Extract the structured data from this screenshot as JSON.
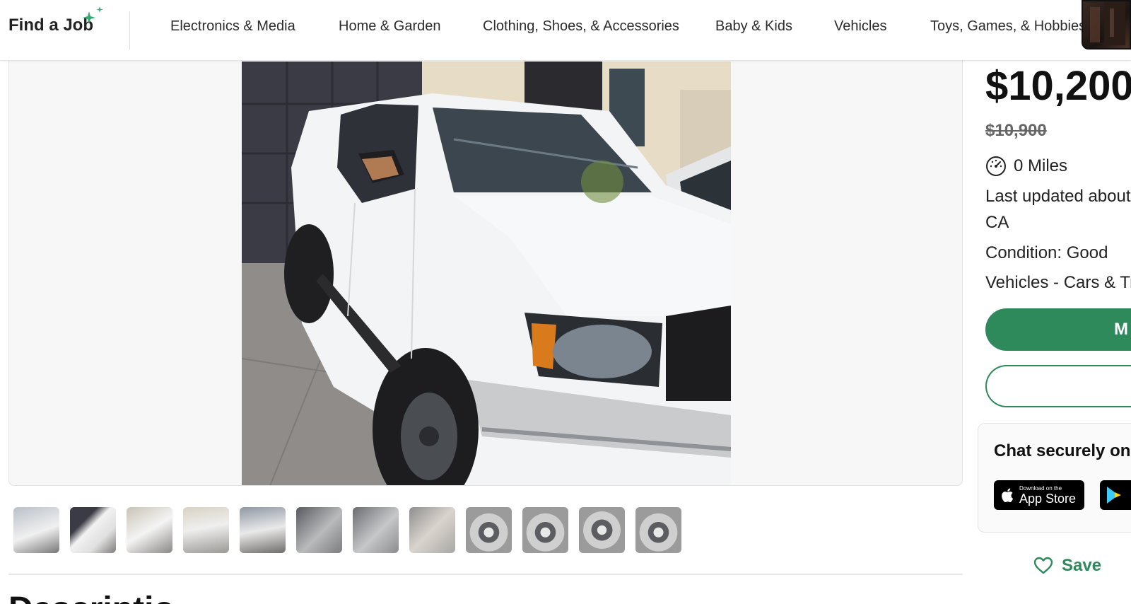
{
  "nav": {
    "brand": "Find a Job",
    "categories": [
      "Electronics & Media",
      "Home & Garden",
      "Clothing, Shoes, & Accessories",
      "Baby & Kids",
      "Vehicles",
      "Toys, Games, & Hobbies"
    ]
  },
  "listing": {
    "price": "$10,200",
    "original_price": "$10,900",
    "mileage": "0 Miles",
    "updated_line1": "Last updated about",
    "updated_line2": "CA",
    "condition": "Condition: Good",
    "category_path": "Vehicles - Cars & Tru",
    "primary_button_label": "M",
    "thumbnail_count": 12
  },
  "chat": {
    "title": "Chat securely on t",
    "app_store_small": "Download on the",
    "app_store_big": "App Store"
  },
  "save_label": "Save",
  "description_heading": "Descriptio",
  "colors": {
    "accent_green": "#2e8a5b",
    "sparkle_green": "#3aa675"
  },
  "icons": [
    "sparkle-icon",
    "speedometer-icon",
    "apple-icon",
    "google-play-icon",
    "heart-icon"
  ]
}
